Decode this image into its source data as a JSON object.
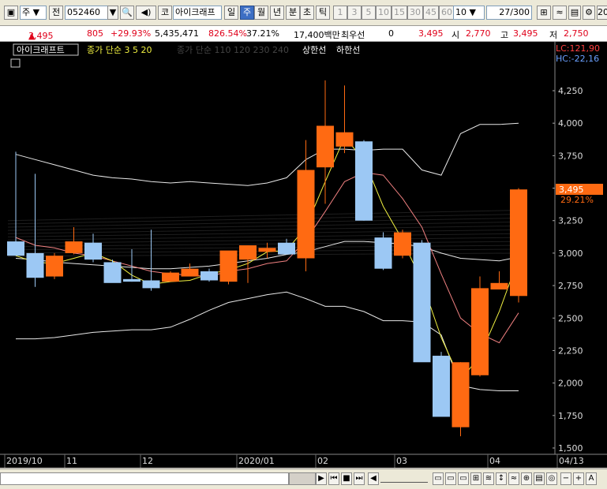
{
  "toolbar": {
    "market": "주",
    "prev_label": "전",
    "code": "052460",
    "type_label": "코",
    "stock_name": "아이크래프",
    "periods": [
      "일",
      "주",
      "월",
      "년",
      "분",
      "초",
      "틱"
    ],
    "selected_period": "주",
    "intervals": [
      "1",
      "3",
      "5",
      "10",
      "15",
      "30",
      "45",
      "60"
    ],
    "interval_value": "10",
    "count_value": "27/300",
    "edge_text": "20"
  },
  "quote": {
    "price": "3,495",
    "change": "805",
    "change_pct": "+29.93%",
    "volume": "5,435,471",
    "vol_ratio": "826.54%",
    "turnover": "37.21%",
    "amount": "17,400백만",
    "name": "최우선",
    "zero": "0",
    "best": "3,495",
    "open_label": "시",
    "open": "2,770",
    "high_label": "고",
    "high": "3,495",
    "low_label": "저",
    "low": "2,750"
  },
  "legend": {
    "stock": "아이크래프트",
    "ma1": "종가 단순 3 5 20",
    "ma2": "종가 단순 110 120 230 240",
    "up_limit": "상한선",
    "down_limit": "하한선",
    "lc": "LC:121,90",
    "hc": "HC:-22,16",
    "price_tag": "3,495",
    "pct_tag": "29.21%"
  },
  "colors": {
    "up": "#ff6a12",
    "down": "#9cc8f4",
    "bg": "#000000",
    "ma3": "#f0f040",
    "ma5": "#f08080",
    "ma20": "#e8e8e8"
  },
  "chart_data": {
    "type": "candlestick",
    "y_ticks": [
      "4,250",
      "4,000",
      "3,750",
      "3,500",
      "3,250",
      "3,000",
      "2,750",
      "2,500",
      "2,250",
      "2,000",
      "1,750",
      "1,500"
    ],
    "x_labels": [
      "2019/10",
      "11",
      "12",
      "2020/01",
      "02",
      "03",
      "04",
      "04/13"
    ],
    "ylim": [
      1500,
      4330
    ],
    "candles": [
      {
        "o": 3090,
        "h": 3780,
        "l": 2980,
        "c": 2980
      },
      {
        "o": 3000,
        "h": 3610,
        "l": 2740,
        "c": 2810
      },
      {
        "o": 2820,
        "h": 3000,
        "l": 2800,
        "c": 2980
      },
      {
        "o": 3000,
        "h": 3200,
        "l": 2990,
        "c": 3090
      },
      {
        "o": 3080,
        "h": 3150,
        "l": 2930,
        "c": 2950
      },
      {
        "o": 2930,
        "h": 2950,
        "l": 2780,
        "c": 2770
      },
      {
        "o": 2800,
        "h": 3030,
        "l": 2780,
        "c": 2780
      },
      {
        "o": 2790,
        "h": 3180,
        "l": 2710,
        "c": 2730
      },
      {
        "o": 2780,
        "h": 2860,
        "l": 2780,
        "c": 2850
      },
      {
        "o": 2820,
        "h": 2920,
        "l": 2820,
        "c": 2880
      },
      {
        "o": 2860,
        "h": 2880,
        "l": 2780,
        "c": 2790
      },
      {
        "o": 2780,
        "h": 3010,
        "l": 2760,
        "c": 3020
      },
      {
        "o": 2950,
        "h": 3060,
        "l": 2770,
        "c": 3060
      },
      {
        "o": 3010,
        "h": 3080,
        "l": 2960,
        "c": 3040
      },
      {
        "o": 3080,
        "h": 3110,
        "l": 3000,
        "c": 2990
      },
      {
        "o": 2960,
        "h": 3870,
        "l": 2860,
        "c": 3640
      },
      {
        "o": 3660,
        "h": 4330,
        "l": 3380,
        "c": 3980
      },
      {
        "o": 3820,
        "h": 4290,
        "l": 3770,
        "c": 3930
      },
      {
        "o": 3860,
        "h": 3870,
        "l": 3250,
        "c": 3250
      },
      {
        "o": 3120,
        "h": 3160,
        "l": 2870,
        "c": 2880
      },
      {
        "o": 2980,
        "h": 3180,
        "l": 2960,
        "c": 3160
      },
      {
        "o": 3080,
        "h": 3100,
        "l": 2180,
        "c": 2160
      },
      {
        "o": 2210,
        "h": 2240,
        "l": 1750,
        "c": 1740
      },
      {
        "o": 1660,
        "h": 2160,
        "l": 1590,
        "c": 2160
      },
      {
        "o": 2060,
        "h": 2820,
        "l": 2050,
        "c": 2730
      },
      {
        "o": 2720,
        "h": 2860,
        "l": 2720,
        "c": 2770
      },
      {
        "o": 2670,
        "h": 3500,
        "l": 2620,
        "c": 3490
      }
    ],
    "ma3": [
      2980,
      2930,
      2920,
      2960,
      3000,
      2940,
      2830,
      2760,
      2780,
      2790,
      2840,
      2870,
      2920,
      3010,
      3020,
      3200,
      3550,
      3890,
      3720,
      3360,
      3100,
      2780,
      2350,
      2020,
      2210,
      2550,
      2960
    ],
    "ma5": [
      3120,
      3060,
      3040,
      3000,
      2980,
      2940,
      2900,
      2860,
      2840,
      2830,
      2820,
      2860,
      2880,
      2920,
      2940,
      3100,
      3320,
      3550,
      3620,
      3600,
      3420,
      3200,
      2840,
      2500,
      2380,
      2310,
      2540
    ],
    "ma20": [
      2960,
      2950,
      2930,
      2920,
      2910,
      2900,
      2890,
      2880,
      2880,
      2890,
      2900,
      2920,
      2940,
      2960,
      2990,
      3010,
      3050,
      3090,
      3090,
      3080,
      3070,
      3050,
      3000,
      2960,
      2950,
      2940,
      2970
    ],
    "env_upper": [
      3760,
      3720,
      3680,
      3640,
      3600,
      3580,
      3570,
      3550,
      3540,
      3550,
      3540,
      3530,
      3520,
      3540,
      3580,
      3720,
      3800,
      3800,
      3790,
      3800,
      3800,
      3640,
      3600,
      3920,
      3990,
      3990,
      4000
    ],
    "env_lower": [
      2340,
      2340,
      2350,
      2370,
      2390,
      2400,
      2410,
      2410,
      2430,
      2490,
      2560,
      2620,
      2650,
      2680,
      2700,
      2650,
      2590,
      2590,
      2550,
      2480,
      2480,
      2470,
      2370,
      1980,
      1950,
      1940,
      1940
    ]
  },
  "bottom": {
    "arrows": [
      "◀",
      "▶",
      "⏮",
      "■",
      "⏭"
    ],
    "tools": [
      "−",
      "+",
      "A"
    ]
  }
}
